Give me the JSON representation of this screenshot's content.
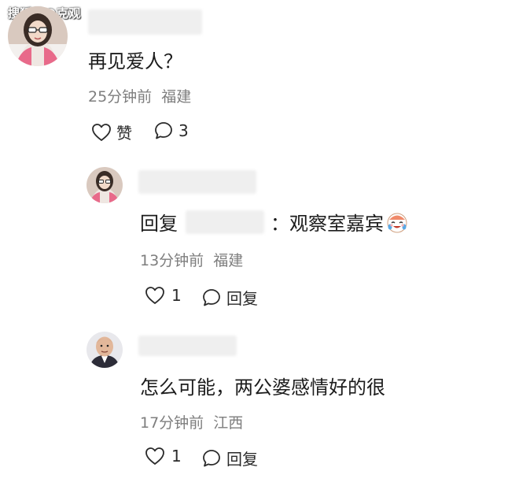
{
  "watermark": "搜狐号@克观",
  "comments": [
    {
      "text": "再见爱人？",
      "time": "25分钟前",
      "location": "福建",
      "like_label": "赞",
      "reply_count": "3"
    },
    {
      "reply_prefix": "回复",
      "reply_text": "：观察室嘉宾",
      "emoji_icon": "crying-laughing-face-icon",
      "time": "13分钟前",
      "location": "福建",
      "like_count": "1",
      "reply_label": "回复"
    },
    {
      "text": "怎么可能，两公婆感情好的很",
      "time": "17分钟前",
      "location": "江西",
      "like_count": "1",
      "reply_label": "回复"
    }
  ],
  "colors": {
    "text": "#1c1c1c",
    "meta": "#7e7e7e",
    "background": "#ffffff"
  }
}
